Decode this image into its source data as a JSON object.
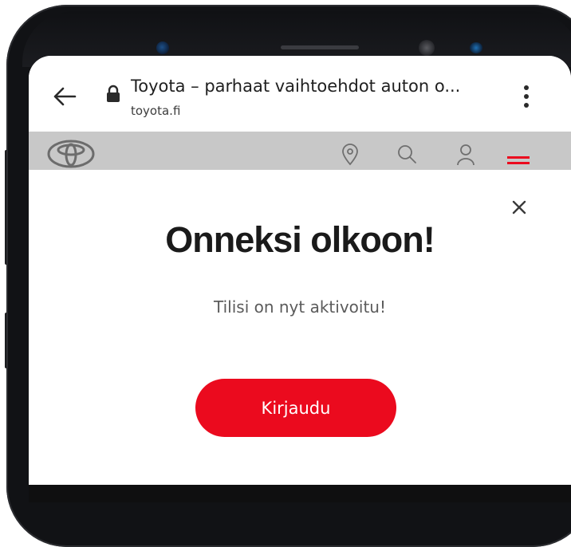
{
  "browser": {
    "page_title": "Toyota – parhaat vaihtoehdot auton o...",
    "domain": "toyota.fi",
    "icons": [
      "back-arrow-icon",
      "lock-icon",
      "more-vertical-icon"
    ]
  },
  "site_nav": {
    "icons": [
      "toyota-logo",
      "location-pin-icon",
      "search-icon",
      "user-icon",
      "hamburger-menu-icon"
    ],
    "menu_color": "#eb0a1e",
    "background": "#c8c8c8"
  },
  "modal": {
    "title": "Onneksi olkoon!",
    "subtitle": "Tilisi on nyt aktivoitu!",
    "button_label": "Kirjaudu",
    "button_color": "#eb0a1e",
    "close_icon": "close-icon"
  }
}
